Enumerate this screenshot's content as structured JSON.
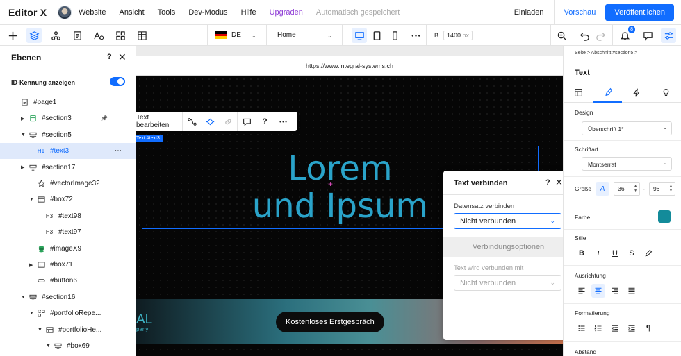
{
  "topbar": {
    "logo": "Editor X",
    "menu": [
      "Website",
      "Ansicht",
      "Tools",
      "Dev-Modus",
      "Hilfe"
    ],
    "upgrade": "Upgraden",
    "autosave": "Automatisch gespeichert",
    "invite": "Einladen",
    "preview": "Vorschau",
    "publish": "Veröffentlichen"
  },
  "toolbar": {
    "language": "DE",
    "page": "Home",
    "width_label": "B",
    "width_value": "1400",
    "width_unit": "px",
    "notification_count": "8",
    "icons": [
      "add-icon",
      "layers-icon",
      "connect-icon",
      "pages-icon",
      "text-styles-icon",
      "apps-icon",
      "table-icon",
      "desktop-icon",
      "tablet-icon",
      "mobile-icon",
      "more-icon",
      "zoom-icon",
      "undo-icon",
      "redo-icon",
      "bell-icon",
      "comment-icon",
      "inspector-icon"
    ]
  },
  "layers": {
    "title": "Ebenen",
    "help": "?",
    "id_toggle_label": "ID-Kennung anzeigen",
    "id_toggle_on": true,
    "items": [
      {
        "name": "#page1",
        "icon": "page-icon",
        "arrow": ""
      },
      {
        "name": "#section3",
        "icon": "section-green-icon",
        "arrow": "▶",
        "pinned": true
      },
      {
        "name": "#section5",
        "icon": "section-icon",
        "arrow": "▼"
      },
      {
        "name": "#text3",
        "icon": "H1",
        "arrow": "",
        "selected": true
      },
      {
        "name": "#section17",
        "icon": "section-icon",
        "arrow": "▶"
      },
      {
        "name": "#vectorImage32",
        "icon": "star-icon",
        "arrow": ""
      },
      {
        "name": "#box72",
        "icon": "box-icon",
        "arrow": "▼"
      },
      {
        "name": "#text98",
        "icon": "H3",
        "arrow": ""
      },
      {
        "name": "#text97",
        "icon": "H3",
        "arrow": ""
      },
      {
        "name": "#imageX9",
        "icon": "image-icon",
        "arrow": ""
      },
      {
        "name": "#box71",
        "icon": "box-icon",
        "arrow": "▶"
      },
      {
        "name": "#button6",
        "icon": "button-icon",
        "arrow": ""
      },
      {
        "name": "#section16",
        "icon": "section-icon",
        "arrow": "▼"
      },
      {
        "name": "#portfolioRepe...",
        "icon": "repeater-icon",
        "arrow": "▼"
      },
      {
        "name": "#portfolioHe...",
        "icon": "box-icon",
        "arrow": "▼"
      },
      {
        "name": "#box69",
        "icon": "section-icon",
        "arrow": "▼"
      }
    ]
  },
  "canvas": {
    "url": "https://www.integral-systems.ch",
    "floating_toolbar_label": "Text bearbeiten",
    "selection_tag": "Text #text3",
    "heading_line1": "Lorem",
    "heading_line2": "und Ipsum",
    "logo_fragment": "AL",
    "logo_sub_fragment": "pany",
    "cta": "Kostenloses Erstgespräch"
  },
  "dialog": {
    "title": "Text verbinden",
    "help": "?",
    "dataset_label": "Datensatz verbinden",
    "dataset_value": "Nicht verbunden",
    "options_button": "Verbindungsoptionen",
    "connected_label": "Text wird verbunden mit",
    "connected_value": "Nicht verbunden"
  },
  "inspector": {
    "breadcrumb": "Seite  >  Abschnitt #section5  >",
    "title": "Text",
    "design_label": "Design",
    "design_value": "Überschrift 1*",
    "font_label": "Schriftart",
    "font_value": "Montserrat",
    "size_label": "Größe",
    "size_value": "36",
    "line_height": "96",
    "color_label": "Farbe",
    "color_value": "#138b9a",
    "styles_label": "Stile",
    "align_label": "Ausrichtung",
    "list_label": "Formatierung",
    "spacing_label": "Abstand"
  }
}
